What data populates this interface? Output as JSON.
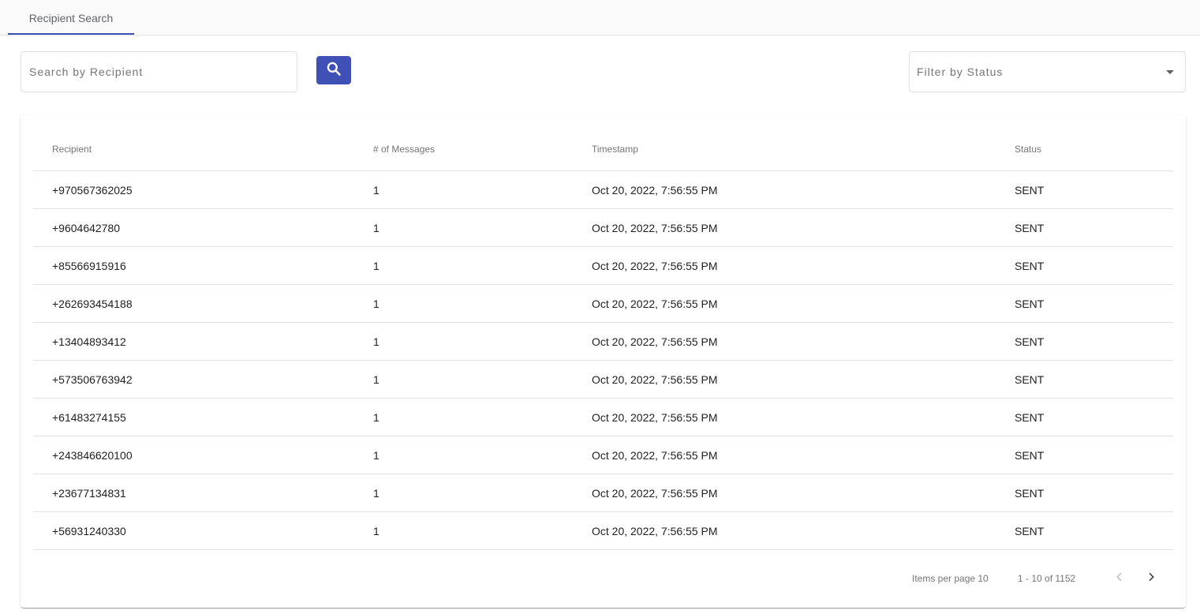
{
  "tabs": [
    {
      "label": "Recipient Search",
      "active": true
    }
  ],
  "search": {
    "placeholder": "Search by Recipient",
    "value": "",
    "button_icon": "search-icon"
  },
  "filter": {
    "placeholder": "Filter by Status",
    "icon": "dropdown-arrow-icon"
  },
  "table": {
    "columns": [
      "Recipient",
      "# of Messages",
      "Timestamp",
      "Status"
    ],
    "rows": [
      [
        "+970567362025",
        "1",
        "Oct 20, 2022, 7:56:55 PM",
        "SENT"
      ],
      [
        "+9604642780",
        "1",
        "Oct 20, 2022, 7:56:55 PM",
        "SENT"
      ],
      [
        "+85566915916",
        "1",
        "Oct 20, 2022, 7:56:55 PM",
        "SENT"
      ],
      [
        "+262693454188",
        "1",
        "Oct 20, 2022, 7:56:55 PM",
        "SENT"
      ],
      [
        "+13404893412",
        "1",
        "Oct 20, 2022, 7:56:55 PM",
        "SENT"
      ],
      [
        "+573506763942",
        "1",
        "Oct 20, 2022, 7:56:55 PM",
        "SENT"
      ],
      [
        "+61483274155",
        "1",
        "Oct 20, 2022, 7:56:55 PM",
        "SENT"
      ],
      [
        "+243846620100",
        "1",
        "Oct 20, 2022, 7:56:55 PM",
        "SENT"
      ],
      [
        "+23677134831",
        "1",
        "Oct 20, 2022, 7:56:55 PM",
        "SENT"
      ],
      [
        "+56931240330",
        "1",
        "Oct 20, 2022, 7:56:55 PM",
        "SENT"
      ]
    ]
  },
  "paginator": {
    "items_per_page_label": "Items per page 10",
    "range_label": "1 - 10 of 1152",
    "prev_icon": "chevron-left-icon",
    "next_icon": "chevron-right-icon"
  },
  "colors": {
    "accent": "#3f51b5",
    "border": "#e0e0e0",
    "muted_text": "#757575"
  }
}
